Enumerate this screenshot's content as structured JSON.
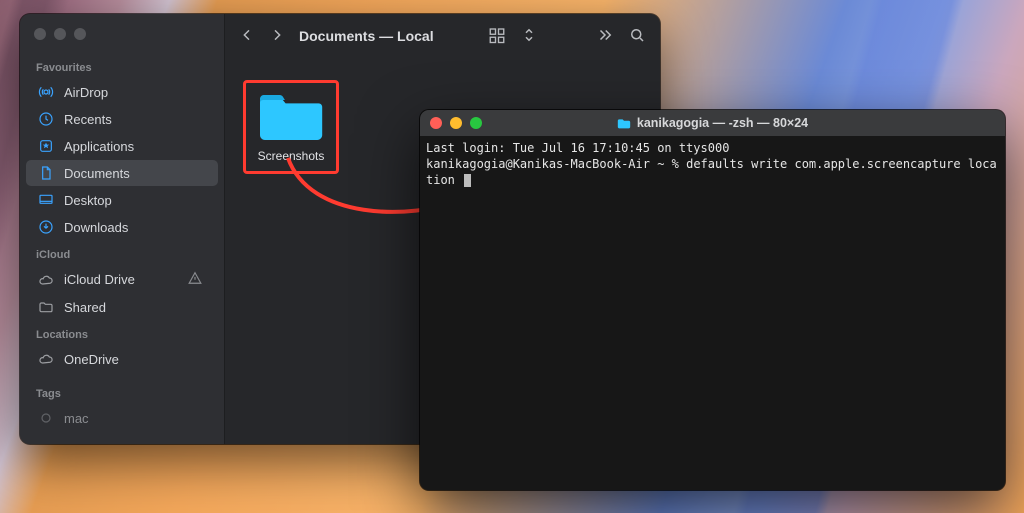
{
  "finder": {
    "title": "Documents — Local",
    "sections": {
      "favourites": "Favourites",
      "icloud": "iCloud",
      "locations": "Locations",
      "tags": "Tags"
    },
    "items": {
      "airdrop": "AirDrop",
      "recents": "Recents",
      "applications": "Applications",
      "documents": "Documents",
      "desktop": "Desktop",
      "downloads": "Downloads",
      "iclouddrive": "iCloud Drive",
      "shared": "Shared",
      "onedrive": "OneDrive",
      "mac": "mac"
    },
    "folder": {
      "name": "Screenshots"
    }
  },
  "terminal": {
    "title": "kanikagogia — -zsh — 80×24",
    "line1": "Last login: Tue Jul 16 17:10:45 on ttys000",
    "prompt": "kanikagogia@Kanikas-MacBook-Air ~ % ",
    "command": "defaults write com.apple.screencapture location "
  },
  "colors": {
    "highlight": "#ff3b30",
    "folder": "#2dc7ff"
  }
}
